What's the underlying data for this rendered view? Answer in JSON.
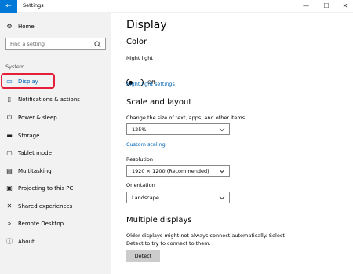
{
  "window": {
    "title": "Settings",
    "back_glyph": "←",
    "minimize_glyph": "—",
    "maximize_glyph": "☐",
    "close_glyph": "✕"
  },
  "sidebar": {
    "home_label": "Home",
    "search_placeholder": "Find a setting",
    "section_label": "System",
    "items": [
      {
        "label": "Display",
        "icon": "monitor-icon",
        "glyph": "▭"
      },
      {
        "label": "Notifications & actions",
        "icon": "notifications-icon",
        "glyph": "▯"
      },
      {
        "label": "Power & sleep",
        "icon": "power-icon",
        "glyph": "⏻"
      },
      {
        "label": "Storage",
        "icon": "storage-icon",
        "glyph": "▬"
      },
      {
        "label": "Tablet mode",
        "icon": "tablet-icon",
        "glyph": "▢"
      },
      {
        "label": "Multitasking",
        "icon": "multitasking-icon",
        "glyph": "▤"
      },
      {
        "label": "Projecting to this PC",
        "icon": "projecting-icon",
        "glyph": "▣"
      },
      {
        "label": "Shared experiences",
        "icon": "shared-experiences-icon",
        "glyph": "✕"
      },
      {
        "label": "Remote Desktop",
        "icon": "remote-desktop-icon",
        "glyph": "»"
      },
      {
        "label": "About",
        "icon": "about-icon",
        "glyph": "ⓘ"
      }
    ],
    "home_glyph": "⚙"
  },
  "main": {
    "title": "Display",
    "color_heading": "Color",
    "night_light_label": "Night light",
    "night_light_state": "Off",
    "night_light_settings_link": "Night light settings",
    "scale_heading": "Scale and layout",
    "scale_label": "Change the size of text, apps, and other items",
    "scale_value": "125%",
    "custom_scaling_link": "Custom scaling",
    "resolution_label": "Resolution",
    "resolution_value": "1920 × 1200 (Recommended)",
    "orientation_label": "Orientation",
    "orientation_value": "Landscape",
    "multiple_heading": "Multiple displays",
    "multiple_desc": "Older displays might not always connect automatically. Select Detect to try to connect to them.",
    "detect_label": "Detect"
  },
  "colors": {
    "accent": "#0078d7",
    "link": "#0063b1",
    "highlight": "#e31f3a",
    "sidebar_bg": "#f2f2f2"
  }
}
